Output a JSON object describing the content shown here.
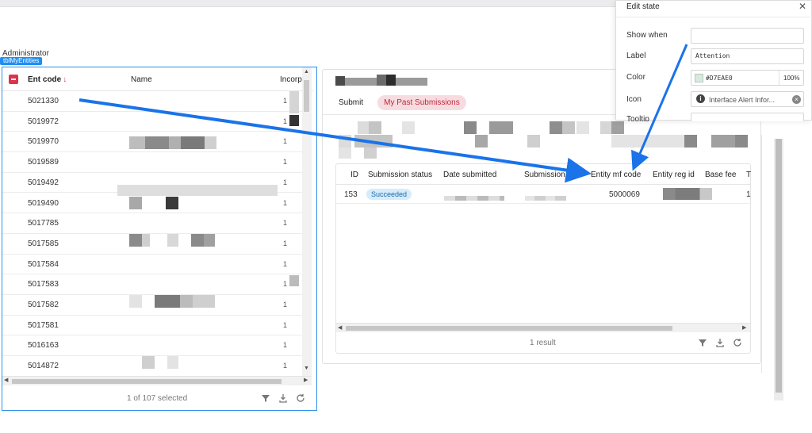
{
  "page": {
    "user_label": "Administrator",
    "component_badge": "tblMyEntities"
  },
  "left_table": {
    "headers": {
      "checkbox": "",
      "ent_code": "Ent code",
      "name": "Name",
      "incorp": "Incorp"
    },
    "rows": [
      {
        "code": "5021330",
        "inc": "1"
      },
      {
        "code": "5019972",
        "inc": "1"
      },
      {
        "code": "5019970",
        "inc": "1"
      },
      {
        "code": "5019589",
        "inc": "1"
      },
      {
        "code": "5019492",
        "inc": "1"
      },
      {
        "code": "5019490",
        "inc": "1"
      },
      {
        "code": "5017785",
        "inc": "1"
      },
      {
        "code": "5017585",
        "inc": "1"
      },
      {
        "code": "5017584",
        "inc": "1"
      },
      {
        "code": "5017583",
        "inc": "1"
      },
      {
        "code": "5017582",
        "inc": "1"
      },
      {
        "code": "5017581",
        "inc": "1"
      },
      {
        "code": "5016163",
        "inc": "1"
      },
      {
        "code": "5014872",
        "inc": "1"
      }
    ],
    "footer_status": "1 of 107 selected"
  },
  "mid_panel": {
    "tabs": [
      {
        "label": "Submit",
        "active": false
      },
      {
        "label": "My Past Submissions",
        "active": true
      }
    ],
    "columns": [
      "ID",
      "Submission status",
      "Date submitted",
      "Submission re",
      "Entity mf code",
      "Entity reg id",
      "Base fee",
      "T"
    ],
    "row": {
      "id": "153",
      "status": "Succeeded",
      "entity_mf_code": "5000069",
      "last": "1"
    },
    "footer_status": "1 result"
  },
  "edit_state": {
    "title": "Edit state",
    "show_when_label": "Show when",
    "show_when_value": "",
    "label_label": "Label",
    "label_value": "Attention",
    "color_label": "Color",
    "color_hex": "#D7EAE0",
    "color_opacity": "100%",
    "icon_label": "Icon",
    "icon_value": "Interface Alert Infor...",
    "tooltip_label": "Tooltip"
  },
  "colors": {
    "accent": "#1f8ef1",
    "danger": "#d9364a",
    "swatch": "#D7EAE0",
    "pill_bg": "#d6ecfb"
  },
  "icons": [
    "sort-down-icon",
    "filter-icon",
    "download-icon",
    "refresh-icon",
    "close-icon",
    "info-icon",
    "clear-icon"
  ]
}
